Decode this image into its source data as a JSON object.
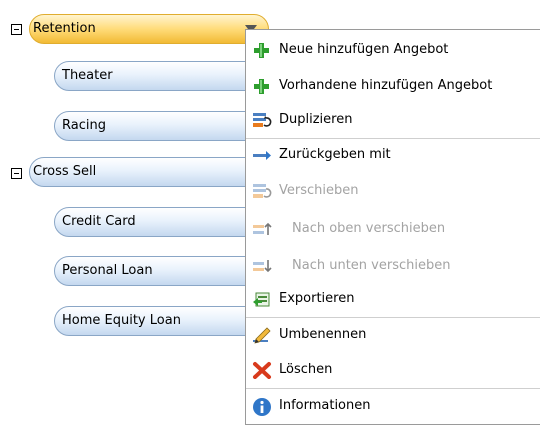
{
  "tree": {
    "retention": {
      "label": "Retention",
      "children": [
        "Theater",
        "Racing"
      ]
    },
    "cross_sell": {
      "label": "Cross Sell",
      "children": [
        "Credit Card",
        "Personal Loan",
        "Home Equity Loan"
      ]
    }
  },
  "context_menu": {
    "items": [
      {
        "label": "Neue hinzufügen Angebot",
        "icon": "plus-icon",
        "enabled": true
      },
      {
        "label": "Vorhandene hinzufügen Angebot",
        "icon": "plus-icon",
        "enabled": true
      },
      {
        "label": "Duplizieren",
        "icon": "duplicate-icon",
        "enabled": true
      },
      {
        "label": "Zurückgeben mit",
        "icon": "return-arrow-icon",
        "enabled": true
      },
      {
        "label": "Verschieben",
        "icon": "move-icon",
        "enabled": false
      },
      {
        "label": "Nach oben verschieben",
        "icon": "move-up-icon",
        "enabled": false
      },
      {
        "label": "Nach unten verschieben",
        "icon": "move-down-icon",
        "enabled": false
      },
      {
        "label": "Exportieren",
        "icon": "export-icon",
        "enabled": true
      },
      {
        "label": "Umbenennen",
        "icon": "rename-pencil-icon",
        "enabled": true
      },
      {
        "label": "Löschen",
        "icon": "delete-x-icon",
        "enabled": true
      },
      {
        "label": "Informationen",
        "icon": "info-icon",
        "enabled": true
      }
    ]
  },
  "colors": {
    "selected_node": "#f2ba35",
    "node": "#c4d8ef",
    "plus_green": "#2e9e2e",
    "delete_red": "#d83a1c",
    "info_blue": "#2f76c8"
  }
}
